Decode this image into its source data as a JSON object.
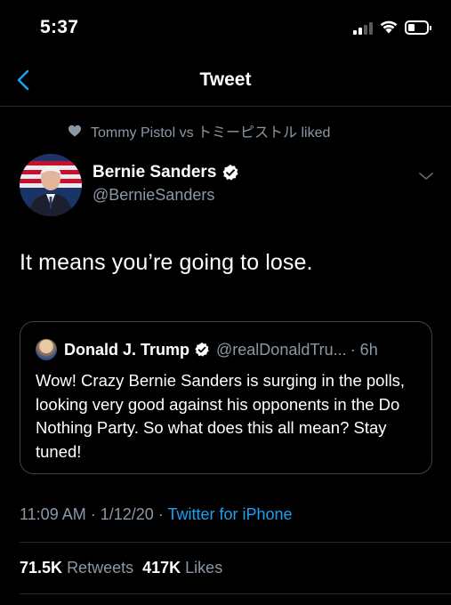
{
  "status_bar": {
    "time": "5:37"
  },
  "nav": {
    "title": "Tweet"
  },
  "social_context": {
    "text": "Tommy Pistol vs トミーピストル liked"
  },
  "tweet": {
    "author_name": "Bernie Sanders",
    "author_handle": "@BernieSanders",
    "text": "It means you’re going to lose."
  },
  "quoted_tweet": {
    "author_name": "Donald J. Trump",
    "author_handle": "@realDonaldTru...",
    "time": "· 6h",
    "text": "Wow! Crazy Bernie Sanders is surging in the polls, looking very good against his opponents in the Do Nothing Party. So what does this all mean? Stay tuned!"
  },
  "meta": {
    "timestamp": "11:09 AM · 1/12/20 ·",
    "source": "Twitter for iPhone"
  },
  "stats": {
    "retweets_count": "71.5K",
    "retweets_label": "Retweets",
    "likes_count": "417K",
    "likes_label": "Likes"
  },
  "colors": {
    "background": "#000000",
    "secondary_text": "#8b98a5",
    "link": "#1da1f2",
    "border": "#38444d"
  },
  "icons": [
    "back-chevron-icon",
    "heart-icon",
    "verified-badge-icon",
    "caret-down-icon",
    "signal-icon",
    "wifi-icon",
    "battery-icon"
  ]
}
